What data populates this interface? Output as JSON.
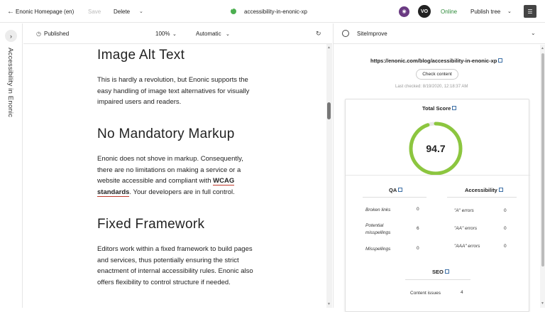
{
  "topbar": {
    "back_icon": "back-arrow-icon",
    "app_title": "Enonic Homepage (en)",
    "save_label": "Save",
    "delete_label": "Delete",
    "page_name": "accessibility-in-enonic-xp",
    "avatar_initials": "VO",
    "online_label": "Online",
    "publish_label": "Publish tree",
    "colors": {
      "online": "#2e8b3a",
      "status": "#4caf50",
      "menu": "#444444"
    }
  },
  "leftrail": {
    "title": "Accessibility in Enonic"
  },
  "preview": {
    "status_label": "Published",
    "zoom": "100%",
    "mode": "Automatic"
  },
  "article": {
    "sections": [
      {
        "heading": "Image Alt Text",
        "text": "This is hardly a revolution, but Enonic supports the easy handling of image text alternatives for visually impaired users and readers."
      },
      {
        "heading": "No Mandatory Markup",
        "text_before": "Enonic does not shove in markup. Consequently, there are no limitations on making a service or a website accessible and compliant with ",
        "link": "WCAG standards",
        "text_after": ". Your developers are in full control."
      },
      {
        "heading": "Fixed Framework",
        "text": "Editors work within a fixed framework to build pages and services, thus potentially ensuring the strict enactment of internal accessibility rules. Enonic also offers flexibility to control structure if needed."
      }
    ]
  },
  "siteimprove": {
    "title": "SiteImprove",
    "url": "https://enonic.com/blog/accessibility-in-enonic-xp",
    "check_button": "Check content",
    "last_checked": "Last checked: 8/19/2020, 12:18:37 AM",
    "total_score_label": "Total Score",
    "total_score": 94.7,
    "total_score_text": "94.7",
    "gauge_color": "#8cc63f",
    "qa": {
      "label": "QA",
      "rows": [
        {
          "label": "Broken links",
          "value": "0"
        },
        {
          "label": "Potential misspellings",
          "value": "6"
        },
        {
          "label": "Misspellings",
          "value": "0"
        }
      ]
    },
    "accessibility": {
      "label": "Accessibility",
      "rows": [
        {
          "label": "\"A\" errors",
          "value": "0"
        },
        {
          "label": "\"AA\" errors",
          "value": "0"
        },
        {
          "label": "\"AAA\" errors",
          "value": "0"
        }
      ]
    },
    "seo": {
      "label": "SEO",
      "rows": [
        {
          "label": "Content issues",
          "value": "4"
        }
      ]
    }
  }
}
